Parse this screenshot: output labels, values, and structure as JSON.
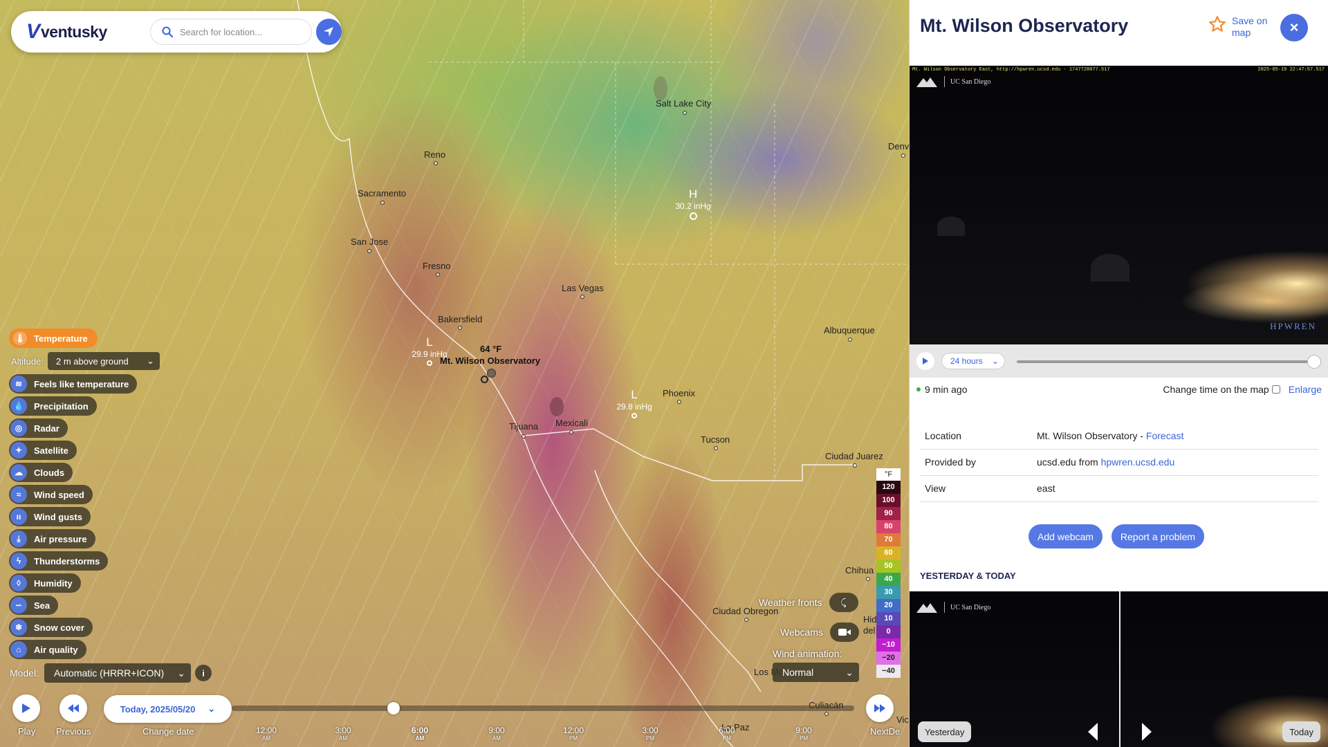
{
  "app": {
    "name": "ventusky",
    "logo_mark": "V"
  },
  "search": {
    "placeholder": "Search for location..."
  },
  "layers": {
    "active": "Temperature",
    "altitude_label": "Altitude:",
    "altitude_value": "2 m above ground",
    "items": [
      {
        "label": "Feels like temperature",
        "icon": "feels-like-icon"
      },
      {
        "label": "Precipitation",
        "icon": "raindrop-icon"
      },
      {
        "label": "Radar",
        "icon": "radar-icon"
      },
      {
        "label": "Satellite",
        "icon": "satellite-icon"
      },
      {
        "label": "Clouds",
        "icon": "cloud-icon"
      },
      {
        "label": "Wind speed",
        "icon": "wind-icon"
      },
      {
        "label": "Wind gusts",
        "icon": "gust-icon"
      },
      {
        "label": "Air pressure",
        "icon": "pressure-icon"
      },
      {
        "label": "Thunderstorms",
        "icon": "lightning-icon"
      },
      {
        "label": "Humidity",
        "icon": "humidity-icon"
      },
      {
        "label": "Sea",
        "icon": "waves-icon"
      },
      {
        "label": "Snow cover",
        "icon": "snowflake-icon"
      },
      {
        "label": "Air quality",
        "icon": "air-quality-icon"
      }
    ]
  },
  "model": {
    "label": "Model:",
    "value": "Automatic (HRRR+ICON)",
    "info": "i"
  },
  "map": {
    "cities": [
      "Salt Lake City",
      "Reno",
      "Sacramento",
      "San Jose",
      "Fresno",
      "Las Vegas",
      "Bakersfield",
      "Phoenix",
      "Tijuana",
      "Mexicali",
      "Tucson",
      "Albuquerque",
      "Ciudad Juarez",
      "Ciudad Obregon",
      "Culiacán",
      "La Paz",
      "Chihua",
      "Denv",
      "Hid del",
      "Los Mo",
      "Vic"
    ],
    "pressure_systems": [
      {
        "letter": "H",
        "value": "30.2 inHg"
      },
      {
        "letter": "L",
        "value": "29.8 inHg"
      },
      {
        "letter": "L",
        "value": "29.9 inHg"
      }
    ],
    "selected_point": {
      "temp": "64 °F",
      "name": "Mt. Wilson Observatory"
    }
  },
  "legend": {
    "unit": "°F",
    "steps": [
      {
        "label": "120",
        "color": "#2a0a10"
      },
      {
        "label": "100",
        "color": "#6a0f2a"
      },
      {
        "label": "90",
        "color": "#a0214a"
      },
      {
        "label": "80",
        "color": "#d8436a"
      },
      {
        "label": "70",
        "color": "#e07a3a"
      },
      {
        "label": "60",
        "color": "#d9b327"
      },
      {
        "label": "50",
        "color": "#a8c422"
      },
      {
        "label": "40",
        "color": "#3aa84a"
      },
      {
        "label": "30",
        "color": "#3a9ab0"
      },
      {
        "label": "20",
        "color": "#3e6ec8"
      },
      {
        "label": "10",
        "color": "#5a4ab8"
      },
      {
        "label": "0",
        "color": "#7a2aa8"
      },
      {
        "label": "−10",
        "color": "#c21ed0"
      },
      {
        "label": "−20",
        "color": "#e070e8"
      },
      {
        "label": "−40",
        "color": "#f0e8f0"
      }
    ]
  },
  "controls": {
    "weather_fronts": "Weather fronts",
    "webcams": "Webcams",
    "wind_animation": "Wind animation:",
    "wind_value": "Normal"
  },
  "timeline": {
    "play": "Play",
    "previous": "Previous",
    "change_date": "Change date",
    "next": "Next",
    "next_tail": "De",
    "date": "Today, 2025/05/20",
    "progress": 0.26,
    "ticks": [
      {
        "time": "12:00",
        "ap": "AM",
        "current": false
      },
      {
        "time": "3:00",
        "ap": "AM",
        "current": false
      },
      {
        "time": "6:00",
        "ap": "AM",
        "current": true
      },
      {
        "time": "9:00",
        "ap": "AM",
        "current": false
      },
      {
        "time": "12:00",
        "ap": "PM",
        "current": false
      },
      {
        "time": "3:00",
        "ap": "PM",
        "current": false
      },
      {
        "time": "6:00",
        "ap": "PM",
        "current": false
      },
      {
        "time": "9:00",
        "ap": "PM",
        "current": false
      }
    ]
  },
  "panel": {
    "title": "Mt. Wilson Observatory",
    "save": "Save on map",
    "close": "×",
    "cam": {
      "header_left": "Mt. Wilson Observatory East, http://hpwren.ucsd.edu - 1747728077.517",
      "header_right": "2025-05-19 22:47:57.517",
      "ucsd": "UC San Diego",
      "brand": "HPWREN"
    },
    "player": {
      "range": "24 hours",
      "progress": 1.0
    },
    "status": {
      "age": "9 min ago",
      "change_time": "Change time on the map",
      "enlarge": "Enlarge"
    },
    "info": {
      "location_k": "Location",
      "location_v": "Mt. Wilson Observatory - ",
      "location_link": "Forecast",
      "provided_k": "Provided by",
      "provided_v": "ucsd.edu from ",
      "provided_link": "hpwren.ucsd.edu",
      "view_k": "View",
      "view_v": "east"
    },
    "add_webcam": "Add webcam",
    "report": "Report a problem",
    "section": "YESTERDAY & TODAY",
    "yesterday": "Yesterday",
    "today": "Today"
  }
}
